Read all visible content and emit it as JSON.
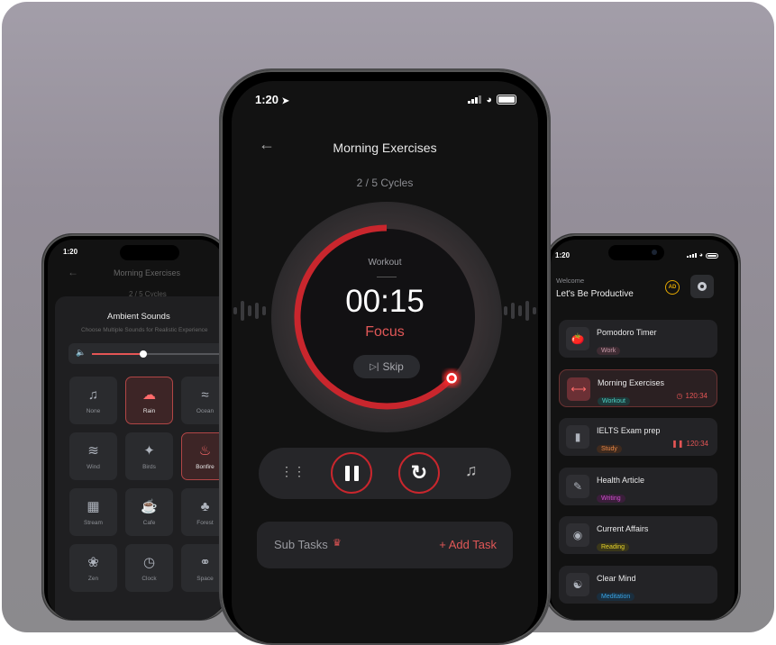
{
  "colors": {
    "accent": "#e43d3d",
    "bg": "#121212",
    "card": "#232326"
  },
  "left_phone": {
    "status_time": "1:20",
    "header_title": "Morning Exercises",
    "cycles": "2 / 5 Cycles",
    "sheet": {
      "title": "Ambient Sounds",
      "subtitle": "Choose Multiple Sounds for Realistic Experience",
      "volume_percent": 40,
      "sounds": [
        {
          "label": "None",
          "icon": "music-off-icon",
          "selected": false
        },
        {
          "label": "Rain",
          "icon": "rain-cloud-icon",
          "selected": true
        },
        {
          "label": "Ocean",
          "icon": "wave-icon",
          "selected": false
        },
        {
          "label": "Wind",
          "icon": "wind-icon",
          "selected": false
        },
        {
          "label": "Birds",
          "icon": "bird-icon",
          "selected": false
        },
        {
          "label": "Bonfire",
          "icon": "fire-icon",
          "selected": true
        },
        {
          "label": "Stream",
          "icon": "waterfall-icon",
          "selected": false
        },
        {
          "label": "Cafe",
          "icon": "coffee-cup-icon",
          "selected": false
        },
        {
          "label": "Forest",
          "icon": "tree-icon",
          "selected": false
        },
        {
          "label": "Zen",
          "icon": "lotus-icon",
          "selected": false
        },
        {
          "label": "Clock",
          "icon": "clock-icon",
          "selected": false
        },
        {
          "label": "Space",
          "icon": "planet-icon",
          "selected": false
        }
      ]
    }
  },
  "center_phone": {
    "status_time": "1:20",
    "header_title": "Morning Exercises",
    "cycles": "2 / 5 Cycles",
    "timer": {
      "category": "Workout",
      "time": "00:15",
      "mode": "Focus",
      "skip_label": "Skip",
      "progress_fraction": 0.63
    },
    "controls": [
      "settings-sliders",
      "pause",
      "restart",
      "music"
    ],
    "subtasks": {
      "label": "Sub Tasks",
      "add_label": "+ Add Task"
    }
  },
  "right_phone": {
    "status_time": "1:20",
    "welcome": "Welcome",
    "headline": "Let's Be Productive",
    "tasks": [
      {
        "title": "Pomodoro Timer",
        "tag": "Work",
        "tag_color": "#c79aa8",
        "tag_bg": "#3e2c33",
        "icon": "tomato-icon",
        "time": "",
        "active": false
      },
      {
        "title": "Morning Exercises",
        "tag": "Workout",
        "tag_color": "#4fd1c5",
        "tag_bg": "#1e3a3a",
        "icon": "dumbbell-icon",
        "time": "120:34",
        "time_icon": "clock",
        "active": true
      },
      {
        "title": "IELTS Exam prep",
        "tag": "Study",
        "tag_color": "#e8894a",
        "tag_bg": "#3e2a1e",
        "icon": "book-icon",
        "time": "120:34",
        "time_icon": "pause",
        "active": false
      },
      {
        "title": "Health Article",
        "tag": "Writing",
        "tag_color": "#d14fcf",
        "tag_bg": "#3a1e3a",
        "icon": "pen-icon",
        "time": "",
        "active": false
      },
      {
        "title": "Current Affairs",
        "tag": "Reading",
        "tag_color": "#e5d12b",
        "tag_bg": "#3a371a",
        "icon": "eye-icon",
        "time": "",
        "active": false
      },
      {
        "title": "Clear Mind",
        "tag": "Meditation",
        "tag_color": "#3aa5e5",
        "tag_bg": "#1a2e3e",
        "icon": "meditation-icon",
        "time": "",
        "active": false
      }
    ]
  }
}
